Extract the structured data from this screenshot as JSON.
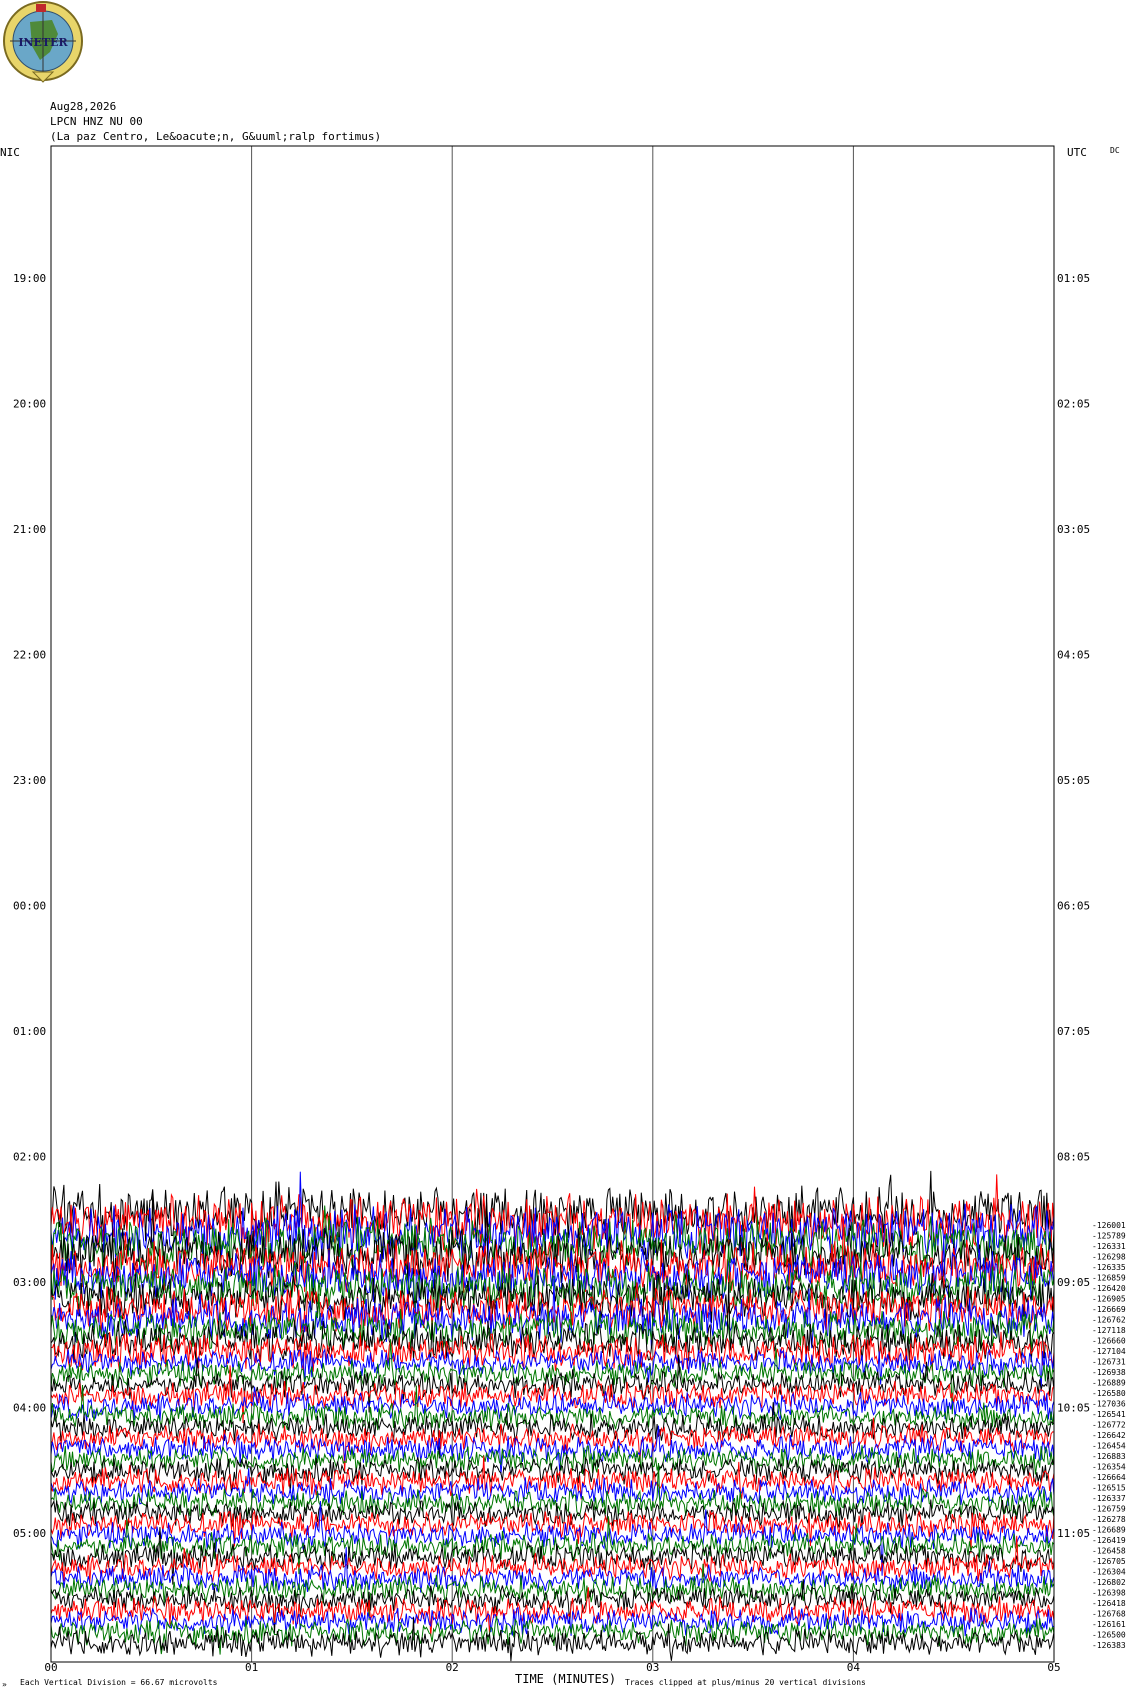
{
  "logo": {
    "text": "INETER"
  },
  "header": {
    "date": "Aug28,2026",
    "station": "LPCN HNZ NU 00",
    "location": "(La paz Centro, Le&oacute;n, G&uuml;ralp fortimus)"
  },
  "labels": {
    "left_tz": "NIC",
    "right_tz": "UTC",
    "dc": "DC",
    "x_title": "TIME (MINUTES)",
    "footer_left": "Each Vertical Division =    66.67 microvolts",
    "footer_right": "Traces clipped at plus/minus 20 vertical divisions",
    "corner": "»"
  },
  "chart_data": {
    "type": "helicorder",
    "x_ticks": [
      "00",
      "01",
      "02",
      "03",
      "04",
      "05"
    ],
    "left_hours": [
      "19:00",
      "20:00",
      "21:00",
      "22:00",
      "23:00",
      "00:00",
      "01:00",
      "02:00",
      "03:00",
      "04:00",
      "05:00"
    ],
    "right_hours": [
      "01:05",
      "02:05",
      "03:05",
      "04:05",
      "05:05",
      "06:05",
      "07:05",
      "08:05",
      "09:05",
      "10:05",
      "11:05"
    ],
    "trace_colors": [
      "#000000",
      "#ff0000",
      "#0000ff",
      "#007700"
    ],
    "dc_offsets": [
      "-126001",
      "-125789",
      "-126331",
      "-126298",
      "-126335",
      "-126859",
      "-126420",
      "-126905",
      "-126669",
      "-126762",
      "-127118",
      "-126660",
      "-127104",
      "-126731",
      "-126938",
      "-126889",
      "-126580",
      "-127036",
      "-126541",
      "-126772",
      "-126642",
      "-126454",
      "-126883",
      "-126354",
      "-126664",
      "-126515",
      "-126337",
      "-126759",
      "-126278",
      "-126689",
      "-126419",
      "-126458",
      "-126705",
      "-126304",
      "-126802",
      "-126398",
      "-126418",
      "-126768",
      "-126161",
      "-126500",
      "-126383"
    ]
  }
}
